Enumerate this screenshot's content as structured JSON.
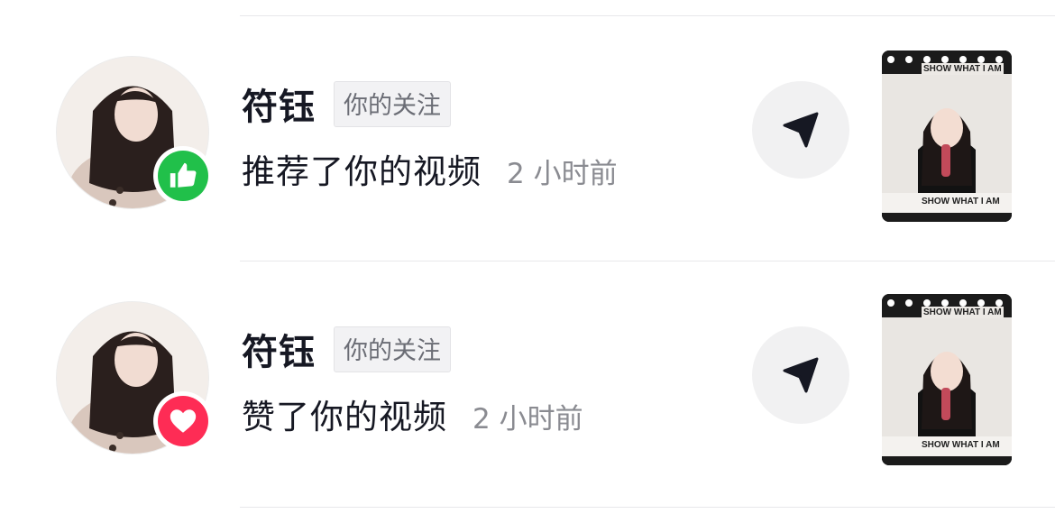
{
  "notifications": [
    {
      "username": "符钰",
      "follow_tag": "你的关注",
      "action": "推荐了你的视频",
      "time": "2 小时前",
      "badge_icon": "thumbs-up-icon",
      "badge_color": "#21c04a",
      "thumbnail_banner": "SHOW WHAT I AM"
    },
    {
      "username": "符钰",
      "follow_tag": "你的关注",
      "action": "赞了你的视频",
      "time": "2 小时前",
      "badge_icon": "heart-icon",
      "badge_color": "#fe2c55",
      "thumbnail_banner": "SHOW WHAT I AM"
    }
  ],
  "share_icon": "send-icon"
}
